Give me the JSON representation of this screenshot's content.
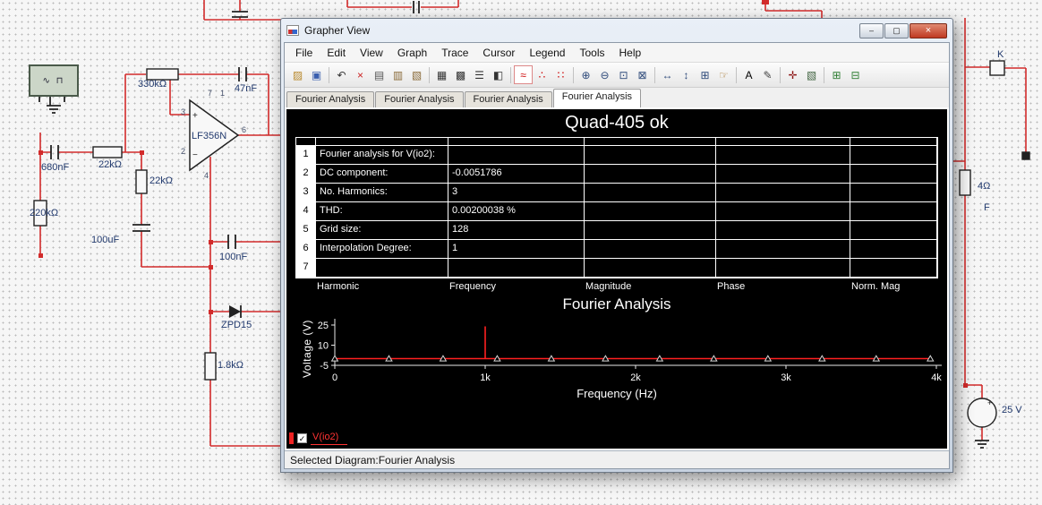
{
  "window": {
    "title": "Grapher View",
    "controls": {
      "minimize": "–",
      "maximize": "▢",
      "close": "×"
    },
    "menu": [
      "File",
      "Edit",
      "View",
      "Graph",
      "Trace",
      "Cursor",
      "Legend",
      "Tools",
      "Help"
    ],
    "toolbar": [
      {
        "name": "open",
        "glyph": "▨",
        "color": "#b98a2e"
      },
      {
        "name": "save",
        "glyph": "▣",
        "color": "#3a5fae"
      },
      {
        "sep": true
      },
      {
        "name": "undo",
        "glyph": "↶",
        "color": "#333333"
      },
      {
        "name": "delete",
        "glyph": "×",
        "color": "#cc2222"
      },
      {
        "name": "copy",
        "glyph": "▤",
        "color": "#555555"
      },
      {
        "name": "copy-graph",
        "glyph": "▥",
        "color": "#8a6b3a"
      },
      {
        "name": "paste",
        "glyph": "▧",
        "color": "#8a6b3a"
      },
      {
        "sep": true
      },
      {
        "name": "show-grid",
        "glyph": "▦",
        "color": "#333333"
      },
      {
        "name": "grid-properties",
        "glyph": "▩",
        "color": "#333333"
      },
      {
        "name": "show-legend",
        "glyph": "☰",
        "color": "#333333"
      },
      {
        "name": "graph-properties",
        "glyph": "◧",
        "color": "#333333"
      },
      {
        "sep": true
      },
      {
        "name": "overlay-traces",
        "glyph": "≈",
        "color": "#cc0000",
        "active": true
      },
      {
        "name": "show-trace-markers",
        "glyph": "∴",
        "color": "#cc0000"
      },
      {
        "name": "show-trace-points",
        "glyph": "∷",
        "color": "#cc0000"
      },
      {
        "sep": true
      },
      {
        "name": "zoom-in",
        "glyph": "⊕",
        "color": "#2e4a7a"
      },
      {
        "name": "zoom-out",
        "glyph": "⊖",
        "color": "#2e4a7a"
      },
      {
        "name": "zoom-area",
        "glyph": "⊡",
        "color": "#2e4a7a"
      },
      {
        "name": "zoom-full",
        "glyph": "⊠",
        "color": "#2e4a7a"
      },
      {
        "sep": true
      },
      {
        "name": "zoom-horizontal",
        "glyph": "↔",
        "color": "#2e4a7a"
      },
      {
        "name": "zoom-vertical",
        "glyph": "↕",
        "color": "#2e4a7a"
      },
      {
        "name": "zoom-selection",
        "glyph": "⊞",
        "color": "#2e4a7a"
      },
      {
        "name": "pan",
        "glyph": "☞",
        "color": "#a8762e"
      },
      {
        "sep": true
      },
      {
        "name": "text-annotation",
        "glyph": "A",
        "color": "#000000"
      },
      {
        "name": "edit-properties",
        "glyph": "✎",
        "color": "#444444"
      },
      {
        "sep": true
      },
      {
        "name": "show-cursors",
        "glyph": "✛",
        "color": "#8a1010"
      },
      {
        "name": "export-report",
        "glyph": "▧",
        "color": "#446644"
      },
      {
        "sep": true
      },
      {
        "name": "export-to-excel",
        "glyph": "⊞",
        "color": "#2e7d32"
      },
      {
        "name": "export-to-csv",
        "glyph": "⊟",
        "color": "#2e7d32"
      }
    ],
    "tabs": [
      "Fourier Analysis",
      "Fourier Analysis",
      "Fourier Analysis",
      "Fourier Analysis"
    ],
    "active_tab": 3,
    "status": "Selected Diagram:Fourier Analysis"
  },
  "report": {
    "title": "Quad-405 ok",
    "rows": [
      {
        "n": "1",
        "label": "Fourier analysis for V(io2):",
        "value": ""
      },
      {
        "n": "2",
        "label": "DC component:",
        "value": "-0.0051786"
      },
      {
        "n": "3",
        "label": "No. Harmonics:",
        "value": "3"
      },
      {
        "n": "4",
        "label": "THD:",
        "value": "0.00200038 %"
      },
      {
        "n": "5",
        "label": "Grid size:",
        "value": "128"
      },
      {
        "n": "6",
        "label": "Interpolation Degree:",
        "value": "1"
      },
      {
        "n": "7",
        "label": "",
        "value": ""
      }
    ],
    "footer_columns": [
      "Harmonic",
      "Frequency",
      "Magnitude",
      "Phase",
      "Norm. Mag"
    ]
  },
  "chart_data": {
    "type": "line",
    "title": "Fourier Analysis",
    "xlabel": "Frequency (Hz)",
    "ylabel": "Voltage (V)",
    "xlim": [
      0,
      4000
    ],
    "ylim": [
      -5,
      27
    ],
    "grid": false,
    "background": "#000000",
    "x_ticks": [
      {
        "label": "0",
        "value": 0
      },
      {
        "label": "1k",
        "value": 1000
      },
      {
        "label": "2k",
        "value": 2000
      },
      {
        "label": "3k",
        "value": 3000
      },
      {
        "label": "4k",
        "value": 4000
      }
    ],
    "y_ticks": [
      {
        "label": "25",
        "value": 25
      },
      {
        "label": "10",
        "value": 10
      },
      {
        "label": "-5",
        "value": -5
      }
    ],
    "series": [
      {
        "name": "V(io2)",
        "color": "#ff2020",
        "baseline": 0,
        "points": [
          [
            0,
            0
          ],
          [
            360,
            0
          ],
          [
            720,
            0
          ],
          [
            1080,
            0
          ],
          [
            1440,
            0
          ],
          [
            1800,
            0
          ],
          [
            2160,
            0
          ],
          [
            2520,
            0
          ],
          [
            2880,
            0
          ],
          [
            3240,
            0
          ],
          [
            3600,
            0
          ],
          [
            3960,
            0
          ]
        ],
        "impulses": [
          [
            1000,
            24
          ]
        ]
      }
    ],
    "legend": {
      "position": "bottom-left",
      "entries": [
        {
          "label": "V(io2)",
          "checked": true
        }
      ]
    }
  },
  "schematic": {
    "generator_glyphs": "∿ ⊓",
    "labels": [
      "330kΩ",
      "47nF",
      "LF356N",
      "680nF",
      "22kΩ",
      "22kΩ",
      "220kΩ",
      "100uF",
      "100nF",
      "ZPD15",
      "1.8kΩ",
      "K",
      "4Ω",
      "F",
      "25 V"
    ],
    "pins": [
      "7",
      "1",
      "3",
      "2",
      "6",
      "4"
    ]
  }
}
